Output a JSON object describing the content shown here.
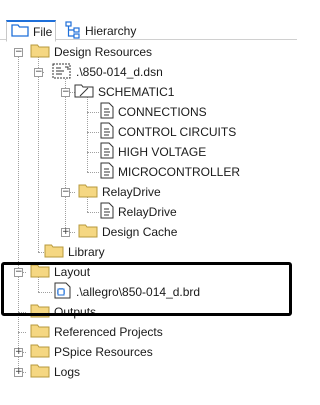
{
  "tabs": [
    {
      "label": "File",
      "icon": "folder-icon",
      "selected": true
    },
    {
      "label": "Hierarchy",
      "icon": "hierarchy-icon",
      "selected": false
    }
  ],
  "tree": {
    "design_resources": "Design Resources",
    "dsn": ".\\850-014_d.dsn",
    "schematic": "SCHEMATIC1",
    "pages": [
      "CONNECTIONS",
      "CONTROL CIRCUITS",
      "HIGH VOLTAGE",
      "MICROCONTROLLER"
    ],
    "relaydrive_folder": "RelayDrive",
    "relaydrive_page": "RelayDrive",
    "design_cache": "Design Cache",
    "library": "Library",
    "layout": "Layout",
    "brd": ".\\allegro\\850-014_d.brd",
    "outputs": "Outputs",
    "referenced_projects": "Referenced Projects",
    "pspice": "PSpice Resources",
    "logs": "Logs"
  },
  "colors": {
    "folder": "#f5d782",
    "folder_stroke": "#b79a3c",
    "tab_accent": "#1e6fd9",
    "highlight_border": "#000000"
  }
}
